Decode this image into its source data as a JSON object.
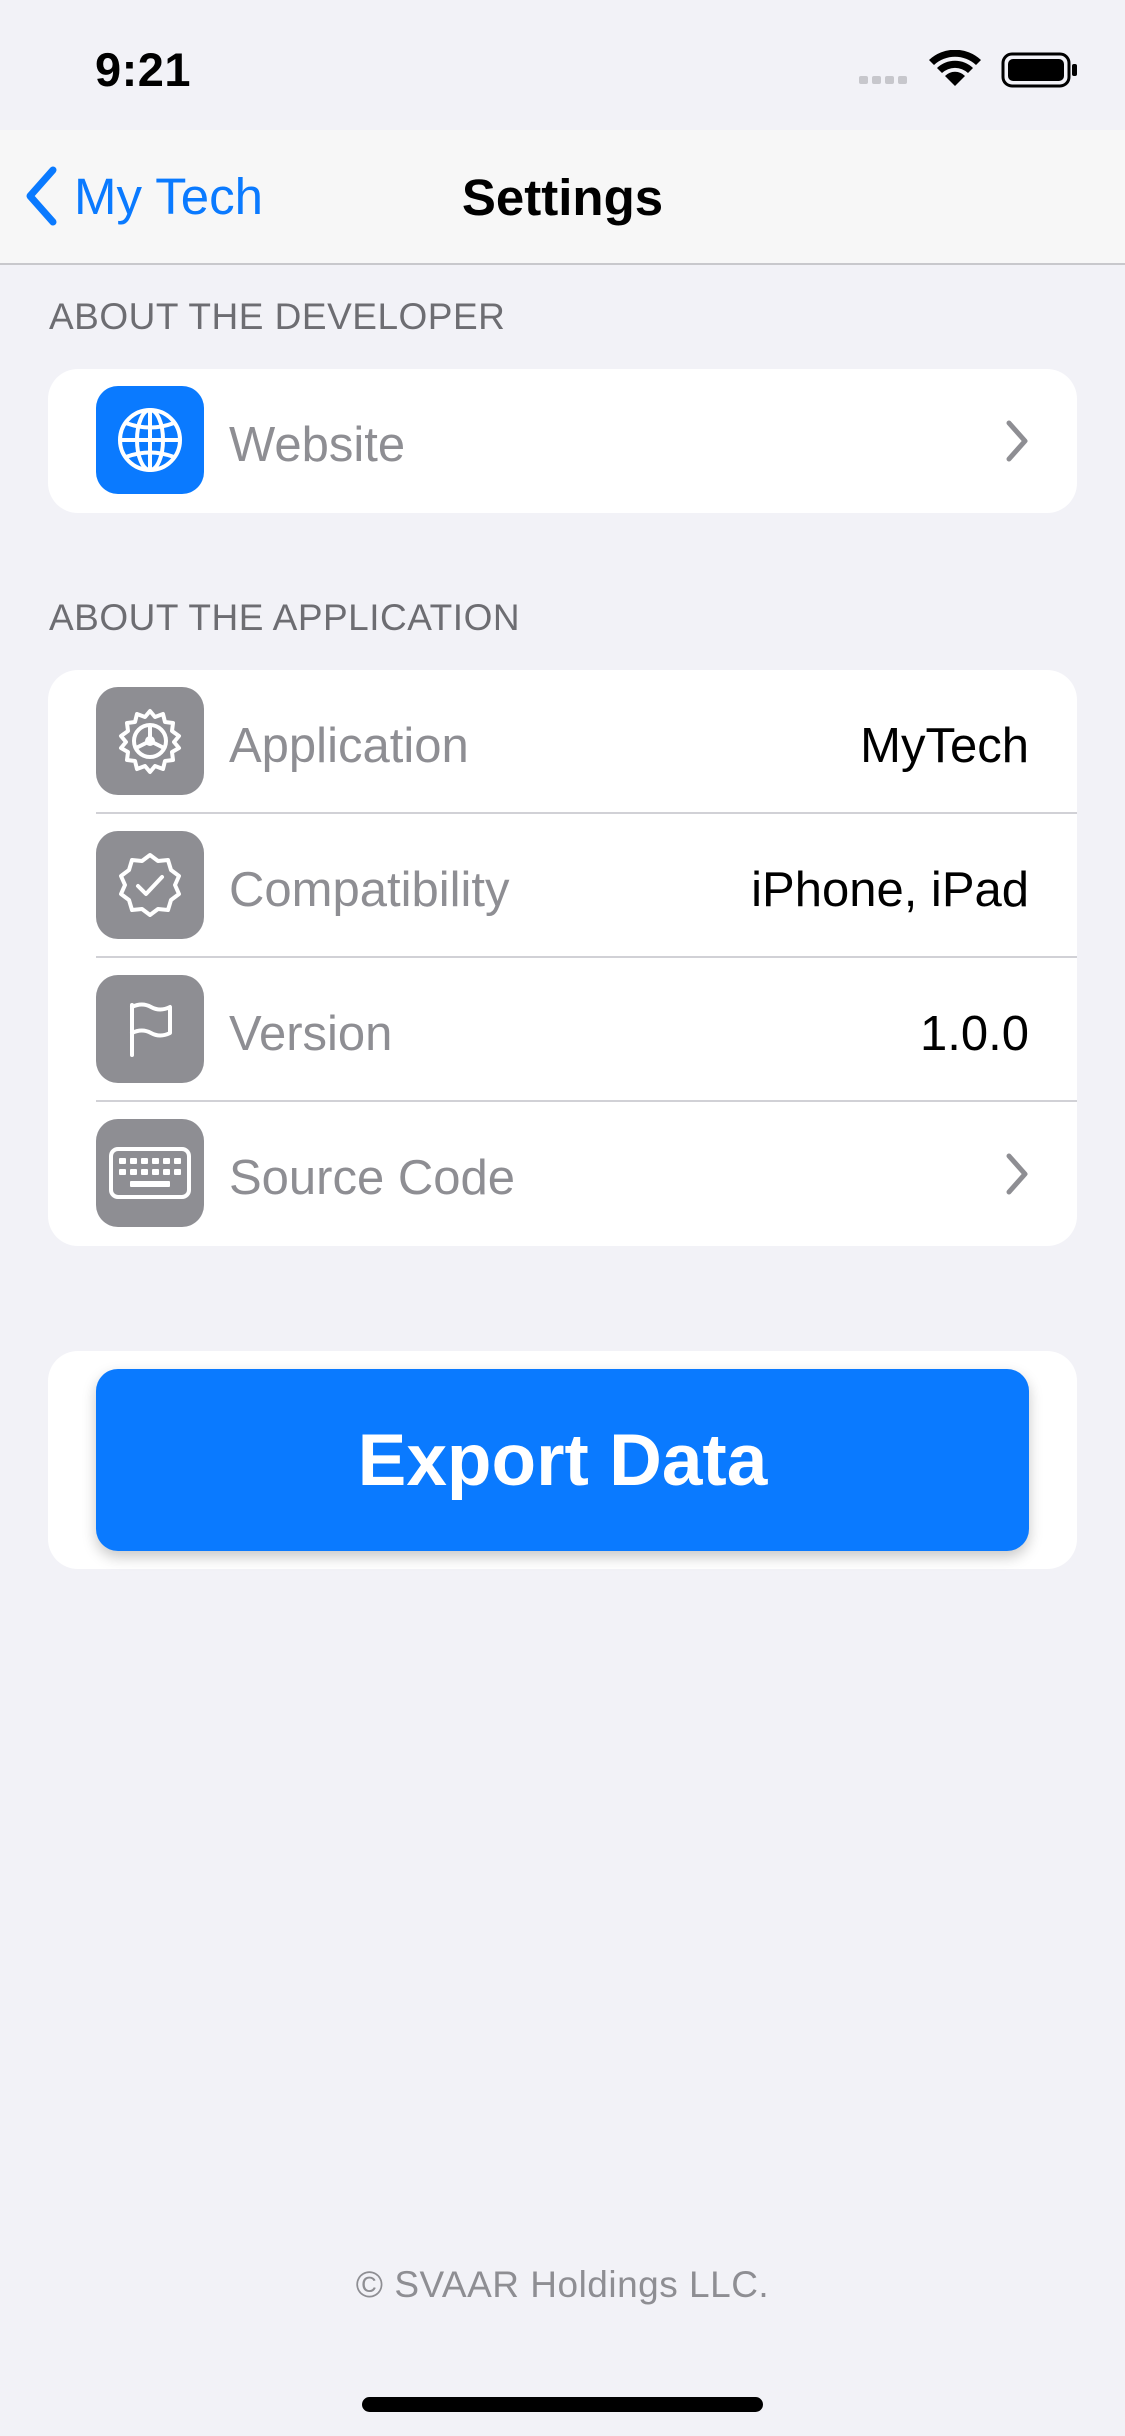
{
  "status_bar": {
    "time": "9:21",
    "icons": [
      "signal-icon",
      "wifi-icon",
      "battery-icon"
    ]
  },
  "nav": {
    "back_label": "My Tech",
    "title": "Settings"
  },
  "developer_section": {
    "header": "ABOUT THE DEVELOPER",
    "rows": [
      {
        "icon": "globe-icon",
        "label": "Website",
        "accessory": "chevron-right-icon"
      }
    ]
  },
  "application_section": {
    "header": "ABOUT THE APPLICATION",
    "rows": [
      {
        "icon": "gear-icon",
        "label": "Application",
        "value": "MyTech"
      },
      {
        "icon": "checkmark-seal-icon",
        "label": "Compatibility",
        "value": "iPhone, iPad"
      },
      {
        "icon": "flag-icon",
        "label": "Version",
        "value": "1.0.0"
      },
      {
        "icon": "keyboard-icon",
        "label": "Source Code",
        "accessory": "chevron-right-icon"
      }
    ]
  },
  "export": {
    "label": "Export Data"
  },
  "footer": {
    "text": "© SVAAR Holdings LLC."
  },
  "colors": {
    "accent": "#0a7aff",
    "background": "#f2f2f7",
    "icon_gray": "#8e8e93",
    "secondary_text": "#6d6d72"
  }
}
